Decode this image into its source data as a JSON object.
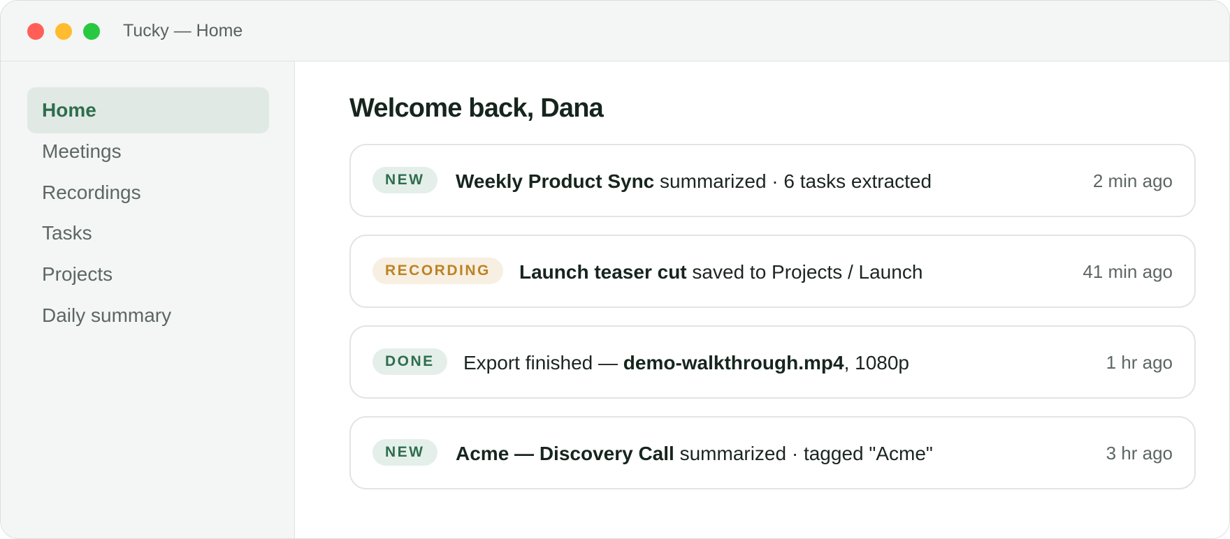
{
  "window": {
    "title": "Tucky — Home"
  },
  "colors": {
    "accent": "#2d6e4d",
    "active_bg": "#e1e9e5",
    "recording_badge_bg": "#f7efe1",
    "recording_badge_text": "#bd8324",
    "traffic_red": "#ff5f57",
    "traffic_yellow": "#febc2e",
    "traffic_green": "#28c840"
  },
  "sidebar": {
    "items": [
      {
        "label": "Home",
        "active": true
      },
      {
        "label": "Meetings",
        "active": false
      },
      {
        "label": "Recordings",
        "active": false
      },
      {
        "label": "Tasks",
        "active": false
      },
      {
        "label": "Projects",
        "active": false
      },
      {
        "label": "Daily summary",
        "active": false
      }
    ]
  },
  "main": {
    "heading": "Welcome back, Dana",
    "activity": [
      {
        "badge": "NEW",
        "badge_color": "green",
        "pre": "",
        "strong": "Weekly Product Sync",
        "post": " summarized · 6 tasks extracted",
        "time": "2 min ago"
      },
      {
        "badge": "RECORDING",
        "badge_color": "amber",
        "pre": "",
        "strong": "Launch teaser cut",
        "post": " saved to Projects / Launch",
        "time": "41 min ago"
      },
      {
        "badge": "DONE",
        "badge_color": "green",
        "pre": "Export finished — ",
        "strong": "demo-walkthrough.mp4",
        "post": ", 1080p",
        "time": "1 hr ago"
      },
      {
        "badge": "NEW",
        "badge_color": "green",
        "pre": "",
        "strong": "Acme — Discovery Call",
        "post": " summarized · tagged \"Acme\"",
        "time": "3 hr ago"
      }
    ]
  }
}
